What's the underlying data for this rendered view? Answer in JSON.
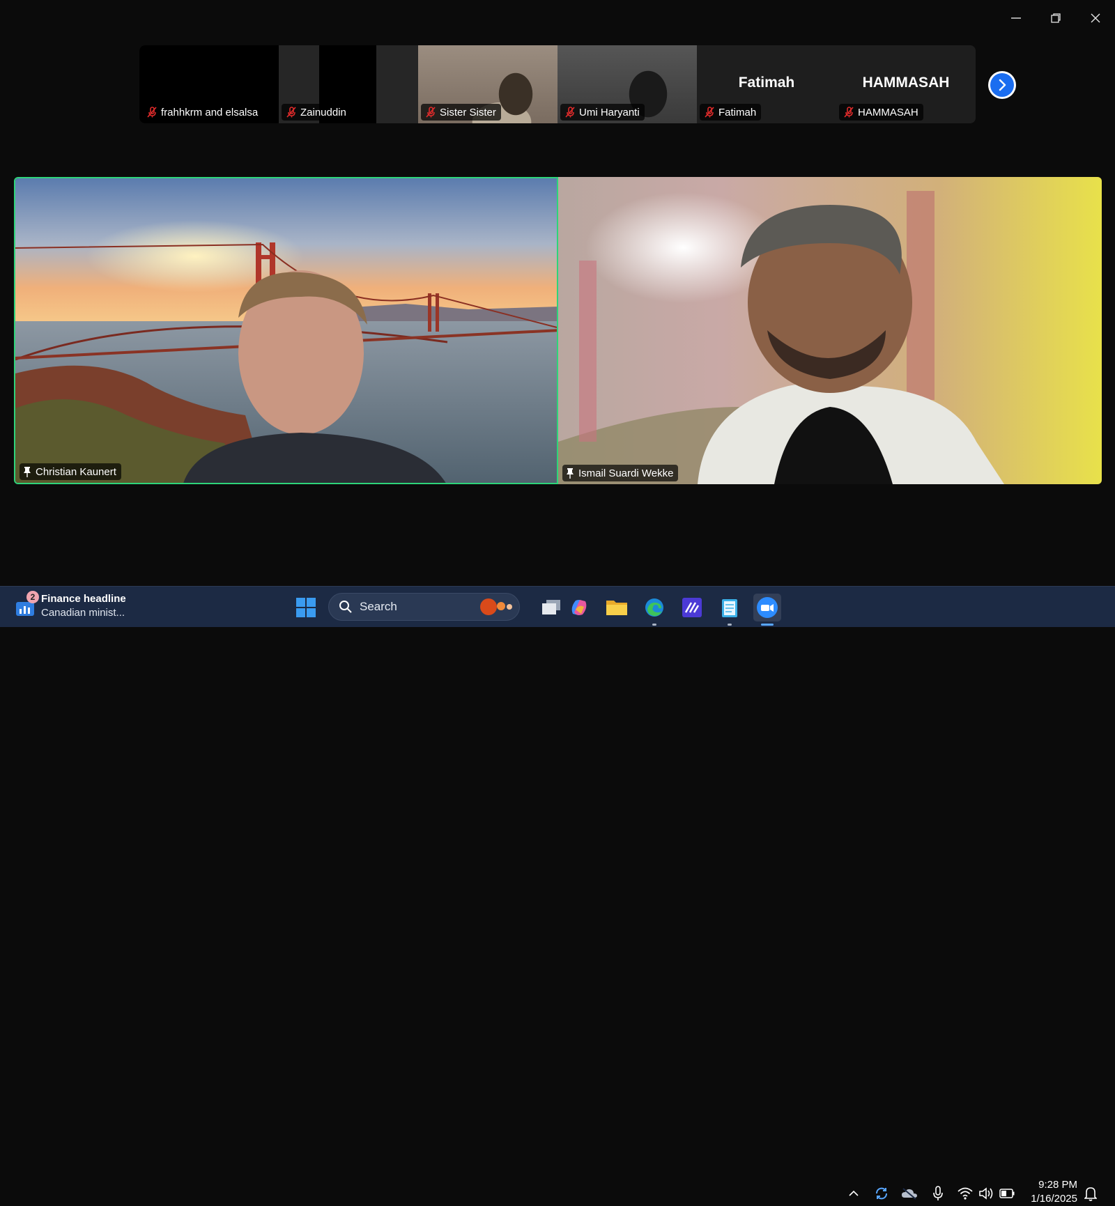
{
  "thumbnails": [
    {
      "name": "frahhkrm and elsalsa",
      "big_name": ""
    },
    {
      "name": "Zainuddin",
      "big_name": ""
    },
    {
      "name": "Sister Sister",
      "big_name": ""
    },
    {
      "name": "Umi Haryanti",
      "big_name": ""
    },
    {
      "name": "Fatimah",
      "big_name": "Fatimah"
    },
    {
      "name": "HAMMASAH",
      "big_name": "HAMMASAH"
    }
  ],
  "speakers": {
    "left": {
      "name": "Christian Kaunert"
    },
    "right": {
      "name": "Ismail Suardi Wekke"
    }
  },
  "taskbar": {
    "news": {
      "badge": "2",
      "title": "Finance headline",
      "subtitle": "Canadian minist..."
    },
    "search_label": "Search",
    "time": "9:28 PM",
    "date": "1/16/2025"
  },
  "colors": {
    "active_speaker_border": "#2ed47a",
    "mic_off": "#e02b2b",
    "next_button": "#1a6df0",
    "taskbar_bg": "#1c2a44"
  }
}
